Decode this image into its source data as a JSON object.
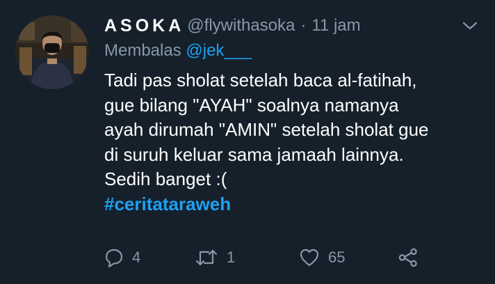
{
  "tweet": {
    "author": {
      "display_name": "ASOKA",
      "handle": "@flywithasoka"
    },
    "separator": "·",
    "time": "11 jam",
    "reply_to": {
      "prefix": "Membalas",
      "mention": "@jek___"
    },
    "text_lines": [
      "Tadi pas sholat setelah baca al-fatihah,",
      "gue bilang \"AYAH\" soalnya namanya",
      "ayah dirumah \"AMIN\" setelah sholat gue",
      "di suruh keluar sama jamaah lainnya.",
      "Sedih banget :("
    ],
    "hashtag": "#ceritataraweh",
    "actions": {
      "reply_count": "4",
      "retweet_count": "1",
      "like_count": "65"
    },
    "icons": {
      "more": "chevron-down-icon",
      "reply": "reply-icon",
      "retweet": "retweet-icon",
      "like": "heart-icon",
      "share": "share-icon"
    },
    "colors": {
      "background": "#15202b",
      "text": "#ffffff",
      "secondary": "#8899a6",
      "link": "#1da1f2"
    }
  }
}
